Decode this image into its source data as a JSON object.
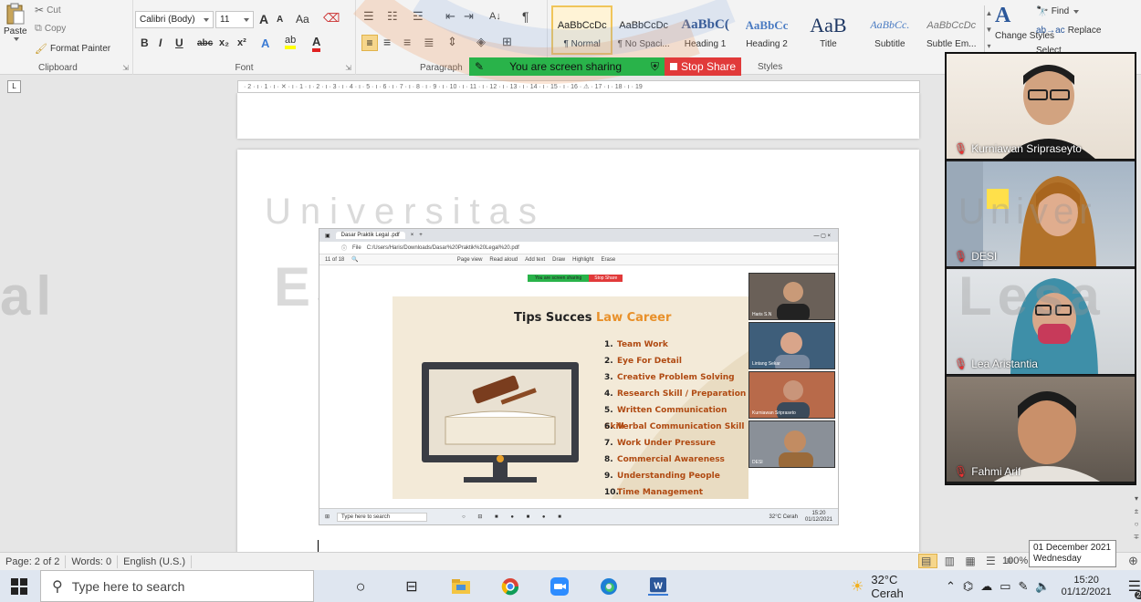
{
  "ribbon": {
    "clipboard": {
      "paste": "Paste",
      "cut": "Cut",
      "copy": "Copy",
      "format_painter": "Format Painter",
      "label": "Clipboard"
    },
    "font": {
      "family": "Calibri (Body)",
      "size": "11",
      "label": "Font",
      "grow": "A",
      "shrink": "A",
      "case": "Aa",
      "bold": "B",
      "italic": "I",
      "underline": "U",
      "strike": "abc",
      "subscript": "x₂",
      "superscript": "x²"
    },
    "paragraph": {
      "label": "Paragraph",
      "sort": "A↓",
      "pilcrow": "¶"
    },
    "styles": {
      "label": "Styles",
      "items": [
        {
          "preview": "AaBbCcDc",
          "name": "¶ Normal"
        },
        {
          "preview": "AaBbCcDc",
          "name": "¶ No Spaci..."
        },
        {
          "preview": "AaBbC(",
          "name": "Heading 1"
        },
        {
          "preview": "AaBbCc",
          "name": "Heading 2"
        },
        {
          "preview": "AaB",
          "name": "Title"
        },
        {
          "preview": "AaBbCc.",
          "name": "Subtitle"
        },
        {
          "preview": "AaBbCcDc",
          "name": "Subtle Em..."
        }
      ],
      "change_styles": "Change Styles"
    },
    "editing": {
      "find": "Find",
      "replace": "Replace",
      "select": "Select"
    }
  },
  "share_bar": {
    "status": "You are screen sharing",
    "stop": "Stop Share"
  },
  "ruler": {
    "marks": "· 2 · ı · 1 · ı · ✕ · ı · 1 · ı · 2 · ı · 3 · ı · 4 · ı · 5 · ı · 6 · ı · 7 · ı · 8 · ı · 9 · ı · 10 · ı · 11 · ı · 12 · ı · 13 · ı · 14 · ı · 15 · ı · 16 · ⚠ · 17 · ı · 18 · ı · 19"
  },
  "watermark": {
    "line1": "Universitas",
    "line2": "Esa Unggul",
    "right": "Lesa",
    "right2": "Univer"
  },
  "embed": {
    "tab_title": "Dasar Praktik Legal .pdf",
    "address_prefix": "File",
    "address": "C:/Users/Haris/Downloads/Dasar%20Praktik%20Legal%20.pdf",
    "page_info": "11  of 18",
    "toolbar": [
      "Page view",
      "Read aloud",
      "Add text",
      "Draw",
      "Highlight",
      "Erase"
    ],
    "share_status": "You are screen sharing",
    "share_stop": "Stop Share",
    "slide": {
      "title_part1": "Tips  Succes ",
      "title_accent": "Law Career",
      "items": [
        "Team Work",
        "Eye For Detail",
        "Creative Problem Solving",
        "Research Skill / Preparation",
        "Written Communication Skill",
        "Verbal Communication Skill",
        "Work Under Pressure",
        "Commercial Awareness",
        "Understanding People",
        "Time Management"
      ],
      "nums": [
        "1.",
        "2.",
        "3.",
        "4.",
        "5.",
        "6.",
        "7.",
        "8.",
        "9.",
        "10."
      ]
    },
    "videos": [
      "Haris S.N",
      "Lintang Sekar",
      "Kurniawan Sripraseto",
      "DESI"
    ],
    "taskbar": {
      "search": "Type here to search",
      "weather": "32°C  Cerah",
      "time": "15:20",
      "date": "01/12/2021"
    }
  },
  "participants": [
    {
      "name": "Kurniawan Sripraseyto"
    },
    {
      "name": "DESI"
    },
    {
      "name": "Lea Aristantia"
    },
    {
      "name": "Fahmi Arif"
    }
  ],
  "statusbar": {
    "page": "Page: 2 of 2",
    "words": "Words: 0",
    "language": "English (U.S.)",
    "zoom": "100%"
  },
  "tooltip": {
    "date": "01 December 2021",
    "day": "Wednesday"
  },
  "taskbar": {
    "search_placeholder": "Type here to search",
    "weather": "32°C  Cerah",
    "time": "15:20",
    "date": "01/12/2021",
    "notifications": "24"
  },
  "colors": {
    "share_green": "#29b34a",
    "share_red": "#e13a3a",
    "accent_orange": "#e8902a",
    "word_blue": "#2b579a"
  }
}
